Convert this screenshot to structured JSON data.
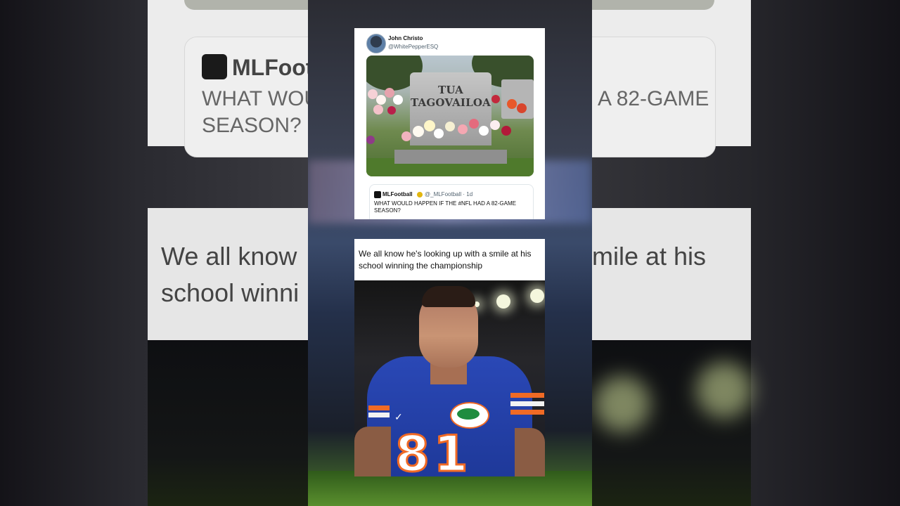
{
  "background": {
    "quoted_account": "MLFootball",
    "quoted_text": "WHAT WOULD HAPPEN IF THE #NFL HAD A 82-GAME SEASON?",
    "meme_caption": "We all know he's looking up with a smile at his school winning the championship",
    "fragments": {
      "account": "MLFootb",
      "line1_left": "WHAT WOUL",
      "line1_right": "A 82-GAME",
      "line2": "SEASON?",
      "cap_line1_left": "We all know",
      "cap_line1_right": "mile at his",
      "cap_line2": "school winni"
    }
  },
  "tweet": {
    "author_name": "John Christo",
    "author_handle": "@WhitePepperESQ",
    "image": {
      "headstone_line1": "TUA",
      "headstone_line2": "TAGOVAILOA"
    },
    "quoted": {
      "name": "MLFootball",
      "handle_time": "@_MLFootball · 1d",
      "text": "WHAT WOULD HAPPEN IF THE #NFL HAD A 82-GAME SEASON?"
    }
  },
  "meme": {
    "caption": "We all know he's looking up with a smile at his school winning the championship",
    "jersey_number": "81"
  },
  "colors": {
    "jersey_blue": "#2a48b6",
    "jersey_orange": "#f06a25",
    "verified_badge": "#e2b60f"
  }
}
